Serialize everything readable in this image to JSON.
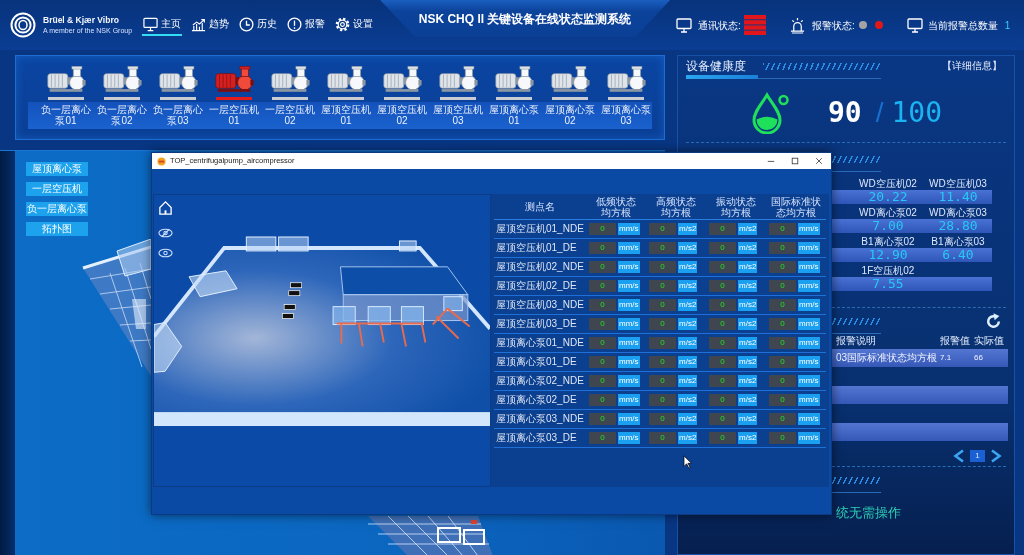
{
  "header": {
    "brand": "Brüel & Kjær Vibro",
    "tagline": "A member of the NSK Group",
    "nav": [
      {
        "label": "主页",
        "kind": "monitor",
        "selected": true
      },
      {
        "label": "趋势",
        "kind": "trend",
        "selected": false
      },
      {
        "label": "历史",
        "kind": "clock",
        "selected": false
      },
      {
        "label": "报警",
        "kind": "alert",
        "selected": false
      },
      {
        "label": "设置",
        "kind": "gear",
        "selected": false
      }
    ],
    "title": "NSK CHQ II 关键设备在线状态监测系统",
    "comm_status_label": "通讯状态:",
    "alarm_status_label": "报警状态:",
    "alarm_lights": [
      {
        "color": "#a3a3a3"
      },
      {
        "color": "#e01818"
      }
    ],
    "alarm_count_label": "当前报警总数量",
    "alarm_count": "1"
  },
  "equipment": [
    {
      "label": "负一层离心泵01",
      "selected": false
    },
    {
      "label": "负一层离心泵02",
      "selected": false
    },
    {
      "label": "负一层离心泵03",
      "selected": false
    },
    {
      "label": "一层空压机01",
      "selected": true
    },
    {
      "label": "一层空压机02",
      "selected": false
    },
    {
      "label": "屋顶空压机01",
      "selected": false
    },
    {
      "label": "屋顶空压机02",
      "selected": false
    },
    {
      "label": "屋顶空压机03",
      "selected": false
    },
    {
      "label": "屋顶离心泵01",
      "selected": false
    },
    {
      "label": "屋顶离心泵02",
      "selected": false
    },
    {
      "label": "屋顶离心泵03",
      "selected": false
    }
  ],
  "sidebar_buttons": [
    "屋顶离心泵",
    "一层空压机",
    "负一层离心泵",
    "拓扑图"
  ],
  "health": {
    "title": "设备健康度",
    "details_link": "【详细信息】",
    "score": "90",
    "separator": "/",
    "max": "100"
  },
  "stats": [
    {
      "label": "WD空压机02",
      "value": "20.22"
    },
    {
      "label": "WD空压机03",
      "value": "11.40"
    },
    {
      "label": "WD离心泵02",
      "value": "7.00"
    },
    {
      "label": "WD离心泵03",
      "value": "28.80"
    },
    {
      "label": "B1离心泵02",
      "value": "12.90"
    },
    {
      "label": "B1离心泵03",
      "value": "6.40"
    },
    {
      "label": "1F空压机02",
      "value": "7.55"
    }
  ],
  "alarms": {
    "columns": [
      "报警说明",
      "报警值",
      "实际值"
    ],
    "rows": [
      {
        "description": "03国际标准状态均方根",
        "alarm_value": "7.1",
        "actual_value": "66"
      }
    ],
    "page": "1"
  },
  "operation_note": "统无需操作",
  "popup": {
    "title": "TOP_centrifugalpump_aircompressor",
    "columns": [
      "测点名",
      "低频状态均方根",
      "高频状态均方根",
      "振动状态均方根",
      "国际标准状态均方根"
    ],
    "rows": [
      {
        "name": "屋顶空压机01_NDE",
        "readings": [
          {
            "value": "0",
            "unit": "mm/s"
          },
          {
            "value": "0",
            "unit": "m/s2"
          },
          {
            "value": "0",
            "unit": "m/s2"
          },
          {
            "value": "0",
            "unit": "mm/s"
          }
        ]
      },
      {
        "name": "屋顶空压机01_DE",
        "readings": [
          {
            "value": "0",
            "unit": "mm/s"
          },
          {
            "value": "0",
            "unit": "m/s2"
          },
          {
            "value": "0",
            "unit": "m/s2"
          },
          {
            "value": "0",
            "unit": "mm/s"
          }
        ]
      },
      {
        "name": "屋顶空压机02_NDE",
        "readings": [
          {
            "value": "0",
            "unit": "mm/s"
          },
          {
            "value": "0",
            "unit": "m/s2"
          },
          {
            "value": "0",
            "unit": "m/s2"
          },
          {
            "value": "0",
            "unit": "mm/s"
          }
        ]
      },
      {
        "name": "屋顶空压机02_DE",
        "readings": [
          {
            "value": "0",
            "unit": "mm/s"
          },
          {
            "value": "0",
            "unit": "m/s2"
          },
          {
            "value": "0",
            "unit": "m/s2"
          },
          {
            "value": "0",
            "unit": "mm/s"
          }
        ]
      },
      {
        "name": "屋顶空压机03_NDE",
        "readings": [
          {
            "value": "0",
            "unit": "mm/s"
          },
          {
            "value": "0",
            "unit": "m/s2"
          },
          {
            "value": "0",
            "unit": "m/s2"
          },
          {
            "value": "0",
            "unit": "mm/s"
          }
        ]
      },
      {
        "name": "屋顶空压机03_DE",
        "readings": [
          {
            "value": "0",
            "unit": "mm/s"
          },
          {
            "value": "0",
            "unit": "m/s2"
          },
          {
            "value": "0",
            "unit": "m/s2"
          },
          {
            "value": "0",
            "unit": "mm/s"
          }
        ]
      },
      {
        "name": "屋顶离心泵01_NDE",
        "readings": [
          {
            "value": "0",
            "unit": "mm/s"
          },
          {
            "value": "0",
            "unit": "m/s2"
          },
          {
            "value": "0",
            "unit": "m/s2"
          },
          {
            "value": "0",
            "unit": "mm/s"
          }
        ]
      },
      {
        "name": "屋顶离心泵01_DE",
        "readings": [
          {
            "value": "0",
            "unit": "mm/s"
          },
          {
            "value": "0",
            "unit": "m/s2"
          },
          {
            "value": "0",
            "unit": "m/s2"
          },
          {
            "value": "0",
            "unit": "mm/s"
          }
        ]
      },
      {
        "name": "屋顶离心泵02_NDE",
        "readings": [
          {
            "value": "0",
            "unit": "mm/s"
          },
          {
            "value": "0",
            "unit": "m/s2"
          },
          {
            "value": "0",
            "unit": "m/s2"
          },
          {
            "value": "0",
            "unit": "mm/s"
          }
        ]
      },
      {
        "name": "屋顶离心泵02_DE",
        "readings": [
          {
            "value": "0",
            "unit": "mm/s"
          },
          {
            "value": "0",
            "unit": "m/s2"
          },
          {
            "value": "0",
            "unit": "m/s2"
          },
          {
            "value": "0",
            "unit": "mm/s"
          }
        ]
      },
      {
        "name": "屋顶离心泵03_NDE",
        "readings": [
          {
            "value": "0",
            "unit": "mm/s"
          },
          {
            "value": "0",
            "unit": "m/s2"
          },
          {
            "value": "0",
            "unit": "m/s2"
          },
          {
            "value": "0",
            "unit": "mm/s"
          }
        ]
      },
      {
        "name": "屋顶离心泵03_DE",
        "readings": [
          {
            "value": "0",
            "unit": "mm/s"
          },
          {
            "value": "0",
            "unit": "m/s2"
          },
          {
            "value": "0",
            "unit": "m/s2"
          },
          {
            "value": "0",
            "unit": "mm/s"
          }
        ]
      }
    ]
  }
}
